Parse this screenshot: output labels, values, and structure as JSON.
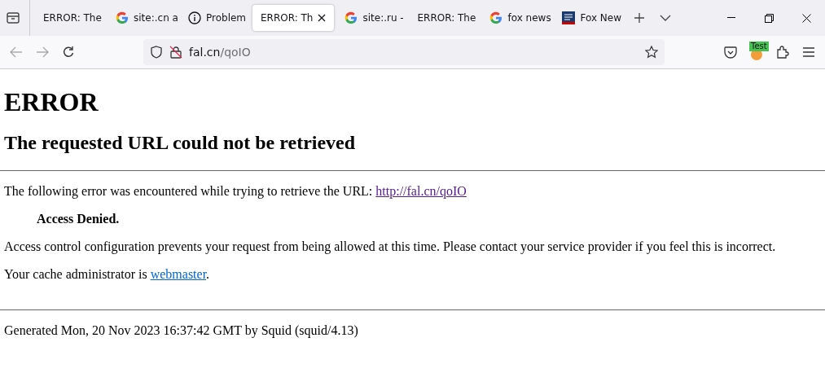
{
  "tabs": [
    {
      "label": "ERROR: The",
      "kind": "plain",
      "selected": false
    },
    {
      "label": "site:.cn a",
      "kind": "search",
      "selected": false
    },
    {
      "label": "Problem",
      "kind": "info",
      "selected": false
    },
    {
      "label": "ERROR: Th",
      "kind": "plain",
      "selected": true
    },
    {
      "label": "site:.ru -",
      "kind": "search",
      "selected": false
    },
    {
      "label": "ERROR: The",
      "kind": "plain",
      "selected": false
    },
    {
      "label": "fox news",
      "kind": "search",
      "selected": false
    },
    {
      "label": "Fox New",
      "kind": "news",
      "selected": false
    }
  ],
  "address": {
    "host": "fal.cn",
    "path": "/qoIO"
  },
  "extension_badge": "Test",
  "page": {
    "title": "ERROR",
    "subtitle": "The requested URL could not be retrieved",
    "intro": "The following error was encountered while trying to retrieve the URL: ",
    "url": "http://fal.cn/qoIO",
    "error": "Access Denied.",
    "explanation": "Access control configuration prevents your request from being allowed at this time. Please contact your service provider if you feel this is incorrect.",
    "admin_text": "Your cache administrator is ",
    "admin_link": "webmaster",
    "admin_end": ".",
    "footer": "Generated Mon, 20 Nov 2023 16:37:42 GMT by Squid (squid/4.13)"
  }
}
